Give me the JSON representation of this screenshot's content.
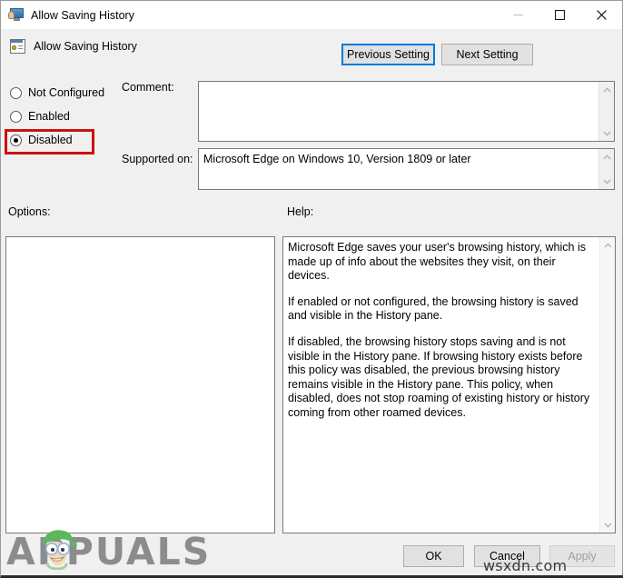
{
  "titlebar": {
    "title": "Allow Saving History",
    "icon": "policy-monitor-icon",
    "minimize": "—",
    "maximize": "□",
    "close": "✕"
  },
  "header": {
    "title": "Allow Saving History",
    "icon": "policy-setting-icon",
    "prev_setting_label": "Previous Setting",
    "next_setting_label": "Next Setting"
  },
  "state": {
    "options": [
      {
        "label": "Not Configured",
        "selected": false
      },
      {
        "label": "Enabled",
        "selected": false
      },
      {
        "label": "Disabled",
        "selected": true
      }
    ],
    "highlighted_option": "Disabled",
    "highlight_color": "#cc1111"
  },
  "comment": {
    "label": "Comment:",
    "value": "",
    "placeholder": ""
  },
  "supported_on": {
    "label": "Supported on:",
    "value": "Microsoft Edge on Windows 10, Version 1809 or later"
  },
  "panels": {
    "options_label": "Options:",
    "options_content": "",
    "help_label": "Help:",
    "help_paragraphs": [
      "Microsoft Edge saves your user's browsing history, which is made up of info about the websites they visit, on their devices.",
      "If enabled or not configured, the browsing history is saved and visible in the History pane.",
      "If disabled, the browsing history stops saving and is not visible in the History pane. If browsing history exists before this policy was disabled, the previous browsing history remains visible in the History pane. This policy, when disabled, does not stop roaming of existing history or history coming from other roamed devices."
    ]
  },
  "footer": {
    "ok_label": "OK",
    "cancel_label": "Cancel",
    "apply_label": "Apply",
    "apply_disabled": true
  },
  "watermarks": {
    "brand": "APPUALS",
    "site": "wsxdn.com"
  }
}
